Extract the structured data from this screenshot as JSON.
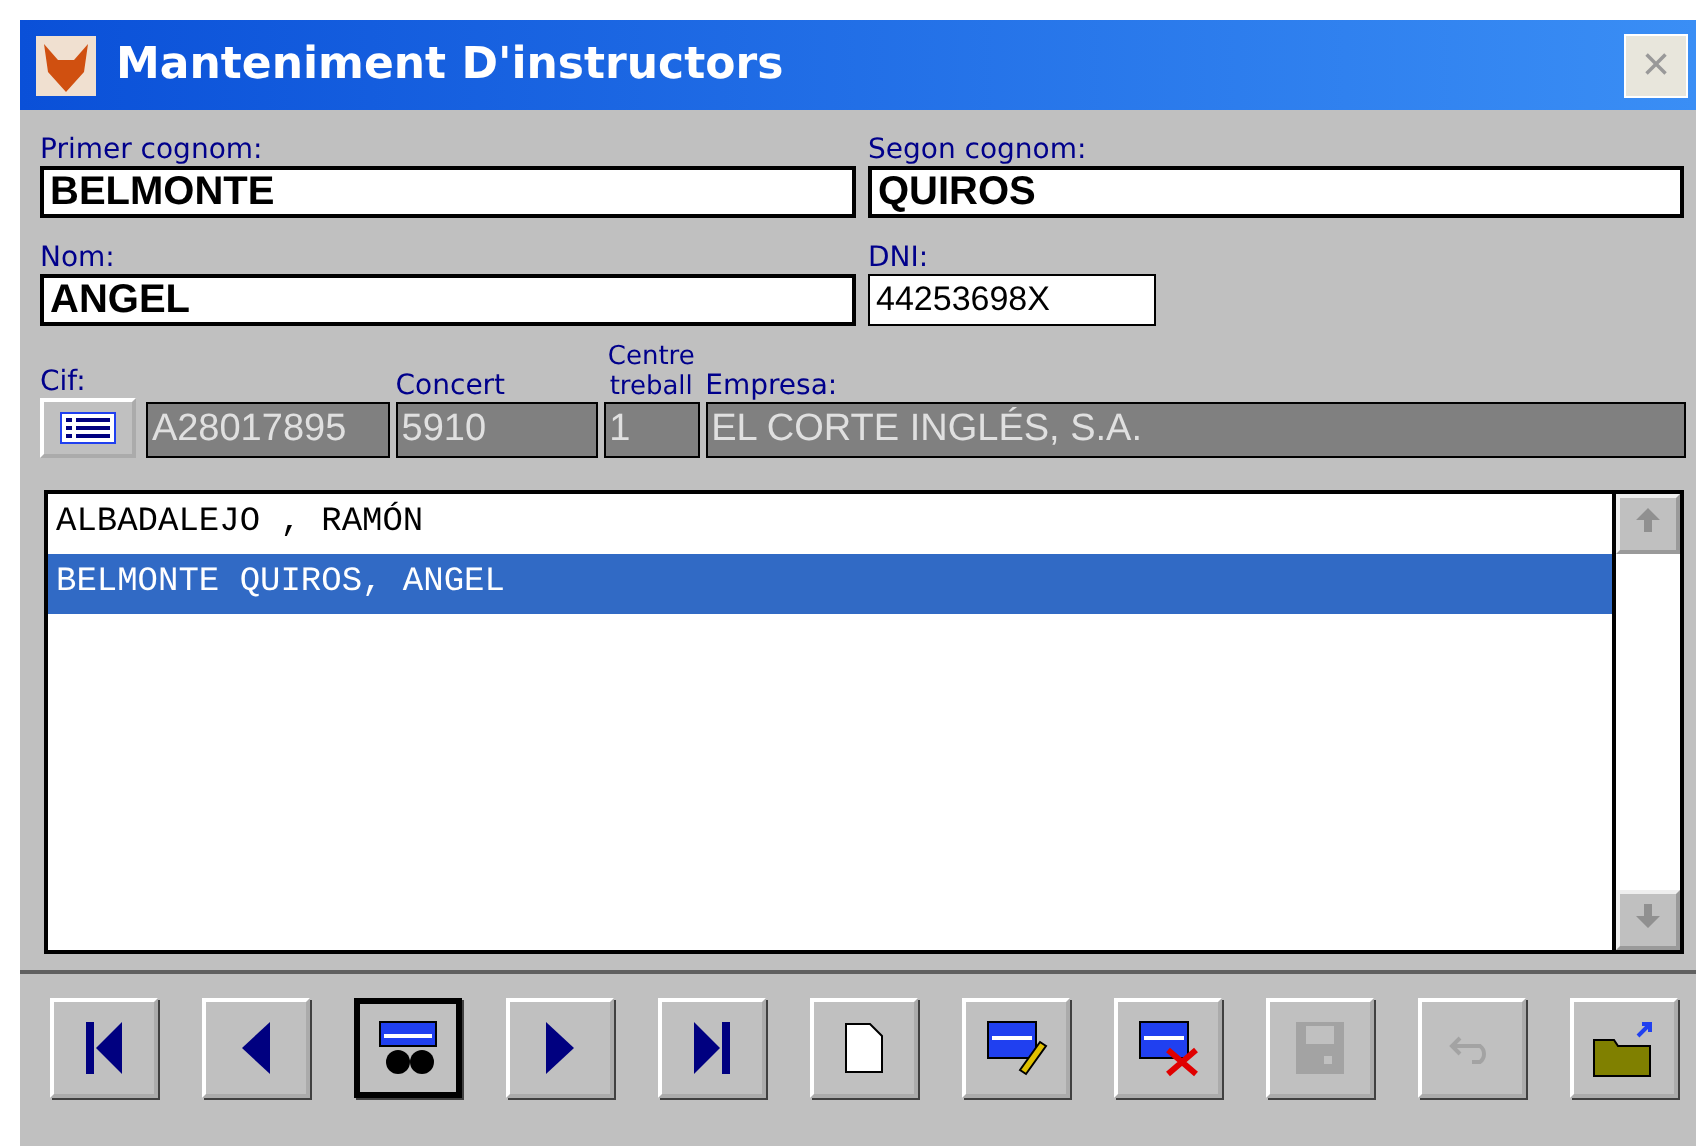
{
  "window": {
    "title": "Manteniment D'instructors",
    "close": "×"
  },
  "fields": {
    "primer_cognom": {
      "label": "Primer cognom:",
      "value": "BELMONTE"
    },
    "segon_cognom": {
      "label": "Segon cognom:",
      "value": "QUIROS"
    },
    "nom": {
      "label": "Nom:",
      "value": "ANGEL"
    },
    "dni": {
      "label": "DNI:",
      "value": "44253698X"
    },
    "cif": {
      "label": "Cif:",
      "value": "A28017895"
    },
    "concert": {
      "label": "Concert",
      "value": "5910"
    },
    "centre_treball": {
      "label": "Centre treball",
      "value": "1"
    },
    "empresa": {
      "label": "Empresa:",
      "value": "EL CORTE INGLÉS, S.A."
    }
  },
  "list": {
    "rows": [
      {
        "text": "ALBADALEJO , RAMÓN",
        "selected": false
      },
      {
        "text": "BELMONTE QUIROS, ANGEL",
        "selected": true
      }
    ]
  },
  "toolbar": [
    {
      "kind": "first",
      "disabled": false,
      "default": false
    },
    {
      "kind": "prev",
      "disabled": false,
      "default": false
    },
    {
      "kind": "search",
      "disabled": false,
      "default": true
    },
    {
      "kind": "next",
      "disabled": false,
      "default": false
    },
    {
      "kind": "last",
      "disabled": false,
      "default": false
    },
    {
      "kind": "new",
      "disabled": false,
      "default": false
    },
    {
      "kind": "edit",
      "disabled": false,
      "default": false
    },
    {
      "kind": "delete",
      "disabled": false,
      "default": false
    },
    {
      "kind": "save",
      "disabled": true,
      "default": false
    },
    {
      "kind": "undo",
      "disabled": true,
      "default": false
    },
    {
      "kind": "exit",
      "disabled": false,
      "default": false
    }
  ]
}
